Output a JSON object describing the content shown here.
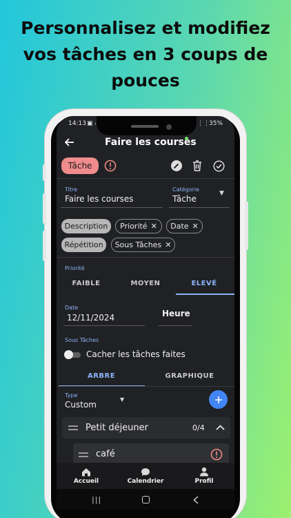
{
  "headline": {
    "line1": "Personnalisez et modifiez",
    "line2": "vos tâches en 3 coups de",
    "line3": "pouces"
  },
  "status_bar": {
    "time": "14:13",
    "battery": "35%"
  },
  "app_bar": {
    "title": "Faire les courses"
  },
  "task_type_chip": "Tâche",
  "fields": {
    "title_label": "Titre",
    "title_value": "Faire les courses",
    "category_label": "Catégorie",
    "category_value": "Tâche"
  },
  "chips": {
    "description": "Description",
    "priorite": "Priorité",
    "date": "Date",
    "repetition": "Répétition",
    "sous_taches": "Sous Tâches"
  },
  "priority": {
    "label": "Priorité",
    "options": [
      "FAIBLE",
      "MOYEN",
      "ELEVÉ"
    ],
    "selected": "ELEVÉ"
  },
  "date": {
    "label": "Date",
    "value": "12/11/2024",
    "hour_label": "Heure"
  },
  "subtasks": {
    "label": "Sous Tâches",
    "hide_done_label": "Cacher les tâches faites",
    "hide_done_on": false,
    "tabs": [
      "ARBRE",
      "GRAPHIQUE"
    ],
    "active_tab": "ARBRE",
    "type_label": "Type",
    "type_value": "Custom",
    "groups": [
      {
        "name": "Petit déjeuner",
        "count": "0/4"
      }
    ],
    "items": [
      {
        "name": "café"
      }
    ]
  },
  "bottom_nav": {
    "items": [
      {
        "label": "Accueil",
        "icon": "home-icon"
      },
      {
        "label": "Calendrier",
        "icon": "chat-icon"
      },
      {
        "label": "Profil",
        "icon": "person-icon"
      }
    ]
  },
  "colors": {
    "accent": "#8ab4f8",
    "fab": "#4285f4",
    "alert": "#f28b82",
    "type_chip": "#f08c8c"
  }
}
